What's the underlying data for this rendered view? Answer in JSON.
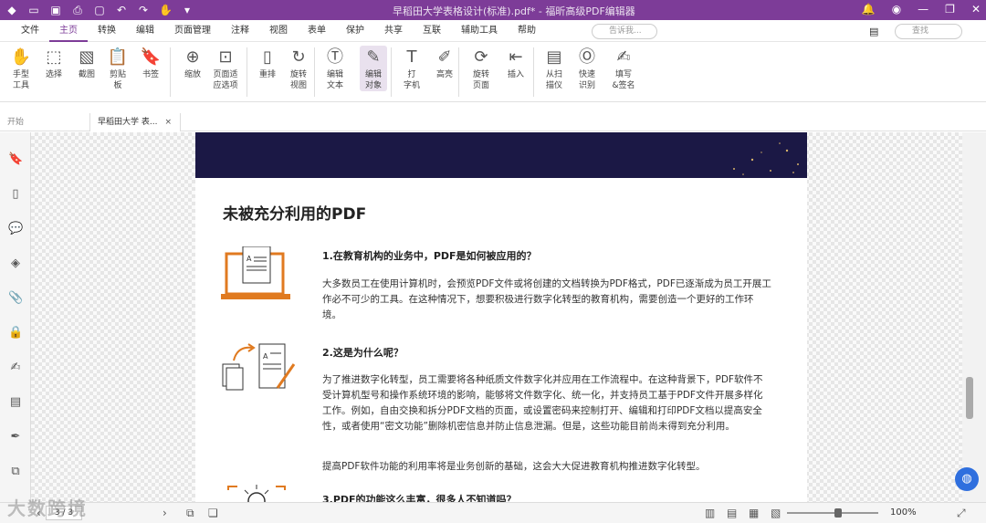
{
  "titlebar": {
    "title": "早稻田大学表格设计(标准).pdf* - 福昕高级PDF编辑器",
    "icons": [
      "app-logo-icon",
      "open-icon",
      "save-icon",
      "print-icon",
      "new-icon",
      "undo-icon",
      "redo-icon",
      "hand-icon",
      "dropdown-icon"
    ]
  },
  "menu": {
    "items": [
      "文件",
      "主页",
      "转换",
      "编辑",
      "页面管理",
      "注释",
      "视图",
      "表单",
      "保护",
      "共享",
      "互联",
      "辅助工具",
      "帮助"
    ],
    "help_search_placeholder": "告诉我...",
    "search_placeholder": "查找"
  },
  "ribbon": {
    "tools": [
      {
        "label": "手型\n工具",
        "icon": "hand-icon"
      },
      {
        "label": "选择",
        "icon": "cursor-icon"
      },
      {
        "label": "截图",
        "icon": "image-icon"
      },
      {
        "label": "剪贴\n板",
        "icon": "clipboard-icon"
      },
      {
        "label": "书签",
        "icon": "bookmark-icon"
      },
      {
        "label": "缩放",
        "icon": "zoom-icon"
      },
      {
        "label": "页面适\n应选项",
        "icon": "fit-page-icon"
      },
      {
        "label": "重排",
        "icon": "reflow-icon"
      },
      {
        "label": "旋转\n视图",
        "icon": "rotate-view-icon"
      },
      {
        "label": "编辑\n文本",
        "icon": "edit-text-icon"
      },
      {
        "label": "编辑\n对象",
        "icon": "edit-object-icon"
      },
      {
        "label": "打\n字机",
        "icon": "typewriter-icon"
      },
      {
        "label": "高亮",
        "icon": "highlight-icon"
      },
      {
        "label": "旋转\n页面",
        "icon": "rotate-page-icon"
      },
      {
        "label": "插入",
        "icon": "insert-icon"
      },
      {
        "label": "从扫\n描仪",
        "icon": "scanner-icon"
      },
      {
        "label": "快速\n识别",
        "icon": "ocr-icon"
      },
      {
        "label": "填写\n&签名",
        "icon": "sign-icon"
      }
    ]
  },
  "tabs": [
    {
      "label": "开始"
    },
    {
      "label": "早稻田大学 表...",
      "close": "×"
    }
  ],
  "sidebar_icons": [
    "bookmark-icon",
    "pages-icon",
    "comment-icon",
    "layers-icon",
    "attachment-icon",
    "security-icon",
    "signature-icon",
    "content-icon",
    "fill-sign-icon",
    "compare-icon"
  ],
  "document": {
    "heading": "未被充分利用的PDF",
    "sections": [
      {
        "q": "1.在教育机构的业务中，PDF是如何被应用的？",
        "p": "大多数员工在使用计算机时，会预览PDF文件或将创建的文档转换为PDF格式，PDF已逐渐成为员工开展工作必不可少的工具。在这种情况下，想要积极进行数字化转型的教育机构，需要创造一个更好的工作环境。"
      },
      {
        "q": "2.这是为什么呢？",
        "p": "为了推进数字化转型，员工需要将各种纸质文件数字化并应用在工作流程中。在这种背景下，PDF软件不受计算机型号和操作系统环境的影响，能够将文件数字化、统一化，并支持员工基于PDF文件开展多样化工作。例如，自由交换和拆分PDF文档的页面，或设置密码来控制打开、编辑和打印PDF文档以提高安全性，或者使用“密文功能”删除机密信息并防止信息泄漏。但是，这些功能目前尚未得到充分利用。",
        "p2": "提高PDF软件功能的利用率将是业务创新的基础，这会大大促进教育机构推进数字化转型。"
      },
      {
        "q": "3.PDF的功能这么丰富，很多人不知道吗？"
      }
    ]
  },
  "status": {
    "page": "3 / 3",
    "zoom": "100%"
  },
  "watermark": "大数跨境"
}
